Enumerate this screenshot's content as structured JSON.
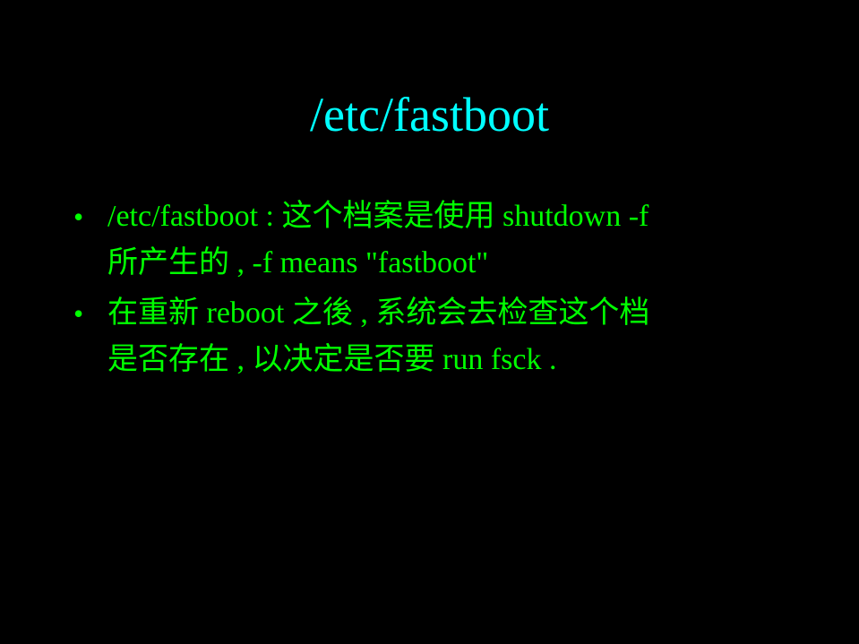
{
  "slide": {
    "title": "/etc/fastboot",
    "colors": {
      "background": "#000000",
      "title": "#00ffff",
      "body": "#00ff00"
    },
    "bullets": [
      {
        "marker": "•",
        "lines": [
          "/etc/fastboot : 这个档案是使用 shutdown -f",
          "所产生的 , -f means \"fastboot\""
        ]
      },
      {
        "marker": "•",
        "lines": [
          "在重新 reboot 之後 , 系统会去检查这个档",
          "是否存在 , 以决定是否要 run fsck ."
        ]
      }
    ]
  }
}
